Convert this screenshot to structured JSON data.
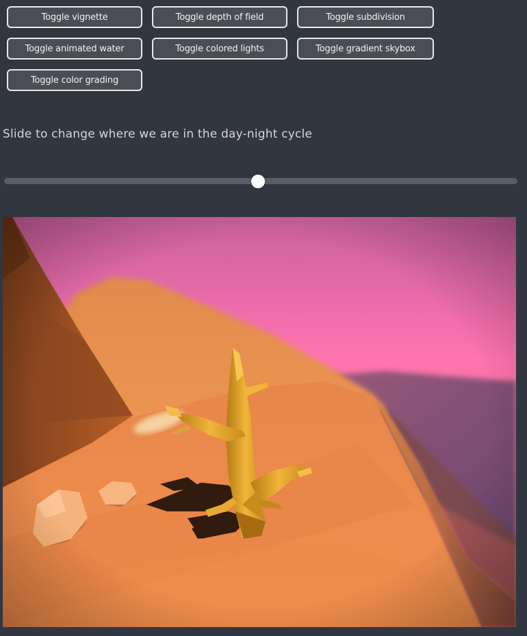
{
  "buttons": [
    {
      "label": "Toggle vignette"
    },
    {
      "label": "Toggle depth of field"
    },
    {
      "label": "Toggle subdivision"
    },
    {
      "label": "Toggle animated water"
    },
    {
      "label": "Toggle colored lights"
    },
    {
      "label": "Toggle gradient skybox"
    },
    {
      "label": "Toggle color grading"
    }
  ],
  "slider": {
    "caption": "Slide to change where we are in the day-night cycle",
    "value": 0.495
  },
  "scene": {
    "sky_top": "#ff6fb0",
    "sky_mid": "#f07ab9",
    "sand_light": "#f19a53",
    "sand_dark": "#a9551f",
    "cactus": "#e3a52a"
  }
}
